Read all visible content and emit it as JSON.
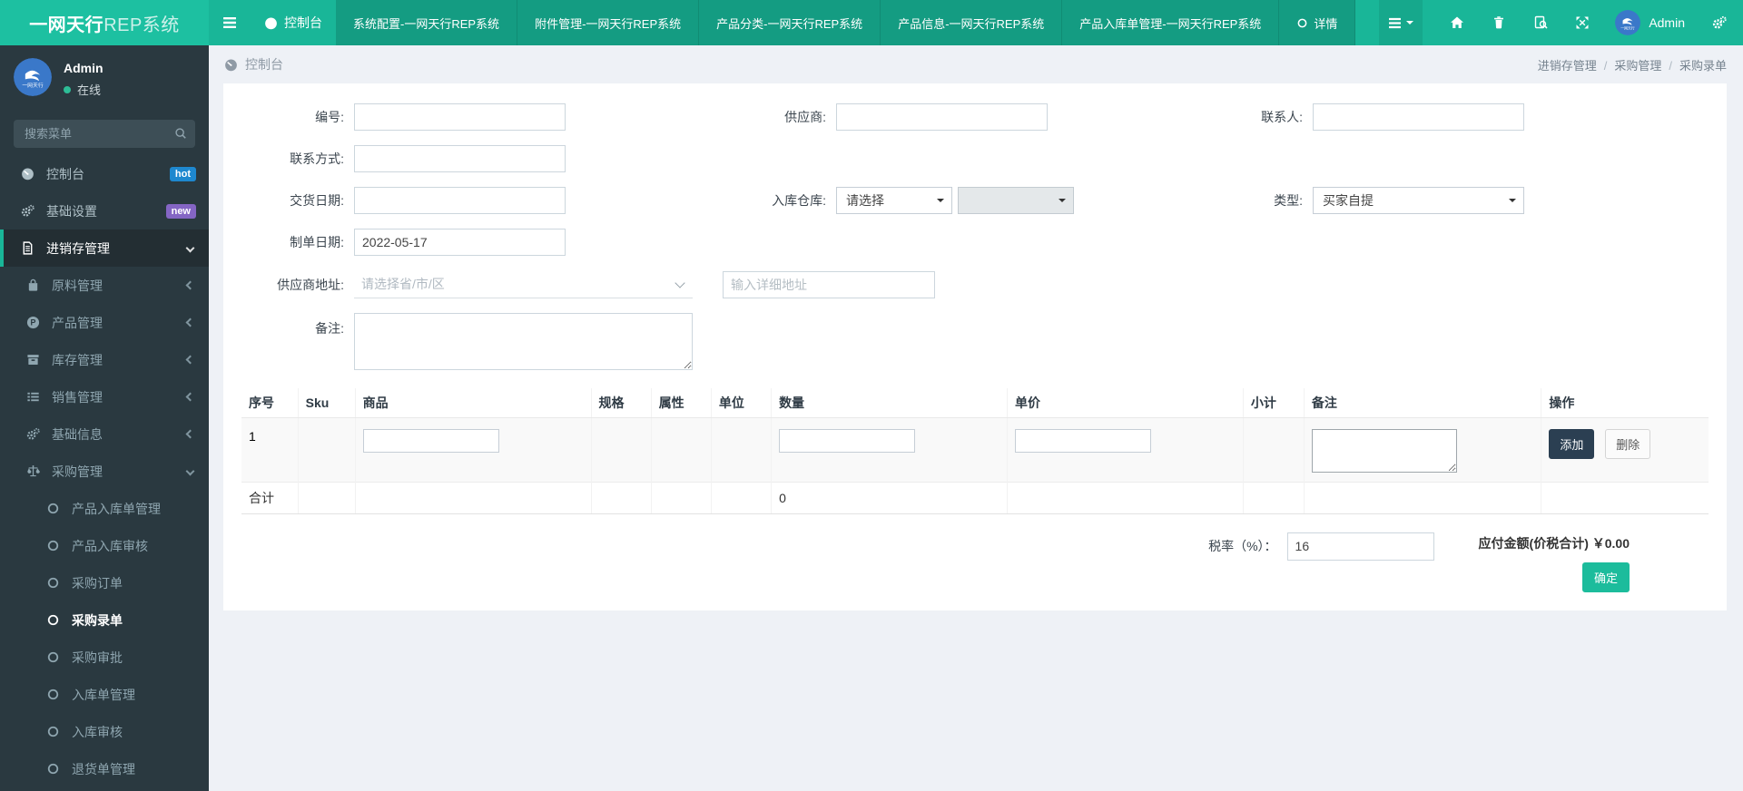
{
  "colors": {
    "navbar_teal": "#19b698",
    "navbar_tab_teal": "#149c82",
    "sidebar_dark": "#2a3940",
    "accent_teal": "#19b698",
    "badge_hot_blue": "#1e88cf",
    "badge_new_purple": "#8465c4",
    "avatar_blue": "#3a78c9",
    "page_bg": "#eef1f6",
    "add_button_navy": "#2b3f52",
    "confirm_button_teal": "#1cbc9c",
    "online_dot_green": "#2dbd96"
  },
  "navbar": {
    "brand_bold": "一网天行",
    "brand_rest": "REP系统",
    "dashboard_label": "控制台",
    "tabs": [
      "系统配置-一网天行REP系统",
      "附件管理-一网天行REP系统",
      "产品分类-一网天行REP系统",
      "产品信息-一网天行REP系统",
      "产品入库单管理-一网天行REP系统"
    ],
    "detail_tab": "详情",
    "user_label": "Admin"
  },
  "sidebar": {
    "user_name": "Admin",
    "user_status": "在线",
    "search_placeholder": "搜索菜单",
    "menu": [
      {
        "label": "控制台",
        "icon": "tacho",
        "level": 1,
        "badge": {
          "text": "hot",
          "bg": "#1e88cf"
        }
      },
      {
        "label": "基础设置",
        "icon": "gears",
        "level": 1,
        "badge": {
          "text": "new",
          "bg": "#8465c4"
        }
      },
      {
        "label": "进销存管理",
        "icon": "file",
        "level": 1,
        "active": true,
        "chevron": "down"
      },
      {
        "label": "原料管理",
        "icon": "bag",
        "level": 2,
        "chevron": "left"
      },
      {
        "label": "产品管理",
        "icon": "prod",
        "level": 2,
        "chevron": "left"
      },
      {
        "label": "库存管理",
        "icon": "archive",
        "level": 2,
        "chevron": "left"
      },
      {
        "label": "销售管理",
        "icon": "list",
        "level": 2,
        "chevron": "left"
      },
      {
        "label": "基础信息",
        "icon": "gears",
        "level": 2,
        "chevron": "left"
      },
      {
        "label": "采购管理",
        "icon": "scale",
        "level": 2,
        "chevron": "down"
      },
      {
        "label": "产品入库单管理",
        "icon": "ring",
        "level": 3
      },
      {
        "label": "产品入库审核",
        "icon": "ring",
        "level": 3
      },
      {
        "label": "采购订单",
        "icon": "ring",
        "level": 3
      },
      {
        "label": "采购录单",
        "icon": "ring",
        "level": 3,
        "active": true
      },
      {
        "label": "采购审批",
        "icon": "ring",
        "level": 3
      },
      {
        "label": "入库单管理",
        "icon": "ring",
        "level": 3
      },
      {
        "label": "入库审核",
        "icon": "ring",
        "level": 3
      },
      {
        "label": "退货单管理",
        "icon": "ring",
        "level": 3
      }
    ]
  },
  "content_header": {
    "title": "控制台",
    "breadcrumb": [
      "进销存管理",
      "采购管理",
      "采购录单"
    ]
  },
  "form": {
    "labels": {
      "code": "编号:",
      "supplier": "供应商:",
      "contact": "联系人:",
      "contact_way": "联系方式:",
      "delivery_date": "交货日期:",
      "warehouse": "入库仓库:",
      "type": "类型:",
      "order_date": "制单日期:",
      "supplier_address": "供应商地址:",
      "remark": "备注:"
    },
    "order_date_value": "2022-05-17",
    "warehouse_placeholder": "请选择",
    "type_value": "买家自提",
    "address_placeholder": "请选择省/市/区",
    "address_detail_placeholder": "输入详细地址"
  },
  "table": {
    "headers": [
      "序号",
      "Sku",
      "商品",
      "规格",
      "属性",
      "单位",
      "数量",
      "单价",
      "小计",
      "备注",
      "操作"
    ],
    "row_index": "1",
    "add_label": "添加",
    "delete_label": "删除",
    "total_label": "合计",
    "total_qty": "0"
  },
  "footer": {
    "tax_label": "税率（%）：",
    "tax_value": "16",
    "amount_label": "应付金额(价税合计)",
    "amount_value": "￥0.00",
    "confirm_label": "确定"
  }
}
